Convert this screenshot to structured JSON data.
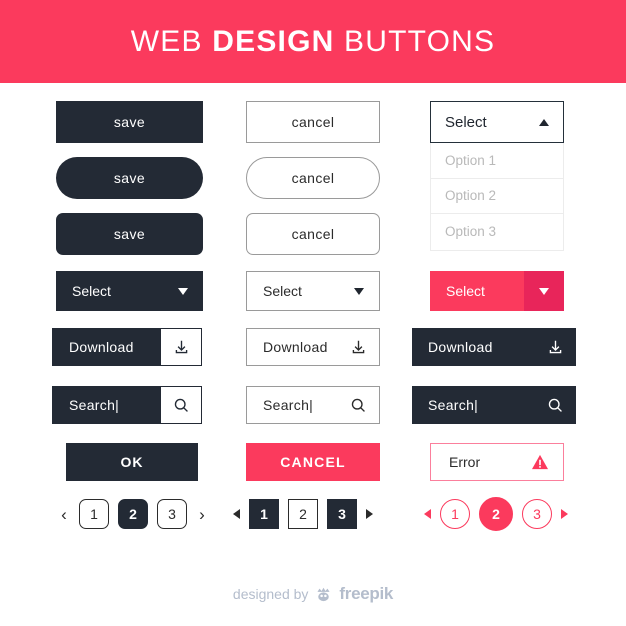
{
  "header": {
    "title_light_1": "WEB ",
    "title_bold": "DESIGN",
    "title_light_2": " BUTTONS",
    "bg_color": "#fb3a5d"
  },
  "colors": {
    "dark": "#232a35",
    "pink": "#fb3a5d",
    "pink_dark": "#e8255a",
    "pink_light_border": "#fb7f9c",
    "outline_gray": "#9a9a9a",
    "option_gray": "#b9b9b9",
    "footer_gray": "#b4bdcc"
  },
  "save_buttons": [
    {
      "label": "save",
      "shape": "square"
    },
    {
      "label": "save",
      "shape": "pill"
    },
    {
      "label": "save",
      "shape": "rounded"
    }
  ],
  "cancel_buttons": [
    {
      "label": "cancel",
      "shape": "square"
    },
    {
      "label": "cancel",
      "shape": "pill"
    },
    {
      "label": "cancel",
      "shape": "rounded"
    }
  ],
  "dropdown_open": {
    "label": "Select",
    "arrow": "caret-up-icon",
    "options": [
      "Option 1",
      "Option 2",
      "Option 3"
    ]
  },
  "select_row": [
    {
      "label": "Select",
      "arrow": "caret-down-icon",
      "style": "dark"
    },
    {
      "label": "Select",
      "arrow": "caret-down-icon",
      "style": "outline"
    },
    {
      "label": "Select",
      "arrow": "caret-down-icon",
      "style": "pink"
    }
  ],
  "download_row": [
    {
      "label": "Download",
      "icon": "download-icon",
      "style": "dark-split"
    },
    {
      "label": "Download",
      "icon": "download-icon",
      "style": "outline"
    },
    {
      "label": "Download",
      "icon": "download-icon",
      "style": "solid"
    }
  ],
  "search_row": [
    {
      "value": "Search",
      "placeholder": "Search",
      "icon": "search-icon",
      "style": "dark-split"
    },
    {
      "value": "Search",
      "placeholder": "Search",
      "icon": "search-icon",
      "style": "outline"
    },
    {
      "value": "Search",
      "placeholder": "Search",
      "icon": "search-icon",
      "style": "solid"
    }
  ],
  "action_row": {
    "ok": {
      "label": "OK"
    },
    "cancel": {
      "label": "CANCEL"
    },
    "error": {
      "label": "Error",
      "icon": "warning-triangle-icon"
    }
  },
  "pagination": [
    {
      "style": "rounded-chevron",
      "prev": "‹",
      "next": "›",
      "pages": [
        "1",
        "2",
        "3"
      ],
      "active_index": 1
    },
    {
      "style": "square-triangle",
      "prev": "triangle-left-icon",
      "next": "triangle-right-icon",
      "pages": [
        "1",
        "2",
        "3"
      ],
      "active_indices": [
        0,
        2
      ]
    },
    {
      "style": "pink-circle",
      "prev": "triangle-left-icon",
      "next": "triangle-right-icon",
      "pages": [
        "1",
        "2",
        "3"
      ],
      "active_index": 1
    }
  ],
  "footer": {
    "text": "designed by",
    "brand": "freepik",
    "logo": "freepik-crown-icon"
  }
}
